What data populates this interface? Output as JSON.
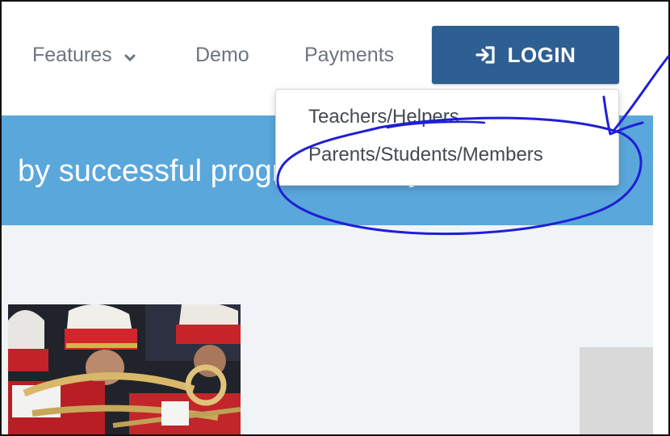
{
  "nav": {
    "features_label": "Features",
    "demo_label": "Demo",
    "payments_label": "Payments",
    "login_label": "LOGIN"
  },
  "dropdown": {
    "items": [
      {
        "label": "Teachers/Helpers"
      },
      {
        "label": "Parents/Students/Members"
      }
    ]
  },
  "banner": {
    "text": "by successful programs everywhere"
  },
  "colors": {
    "login_button": "#2e5f93",
    "banner": "#5aa7dc",
    "annotation_ink": "#1f1fd6",
    "content_bg": "#f1f4f7"
  }
}
